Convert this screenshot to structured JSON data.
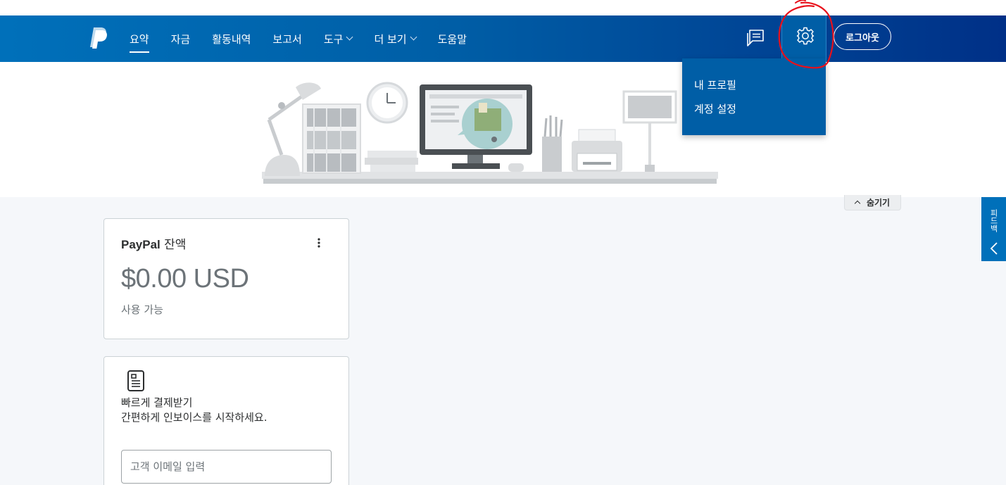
{
  "header": {
    "nav": [
      {
        "label": "요약",
        "active": true
      },
      {
        "label": "자금"
      },
      {
        "label": "활동내역"
      },
      {
        "label": "보고서"
      },
      {
        "label": "도구",
        "has_dropdown": true
      },
      {
        "label": "더 보기",
        "has_dropdown": true
      },
      {
        "label": "도움말"
      }
    ],
    "logout_label": "로그아웃"
  },
  "settings_menu": {
    "items": [
      "내 프로필",
      "계정 설정"
    ]
  },
  "hide_button_label": "숨기기",
  "feedback_tab_label": "피드백",
  "balance_card": {
    "title_brand": "PayPal",
    "title_rest": " 잔액",
    "amount": "$0.00 USD",
    "subtitle": "사용 가능"
  },
  "invoice_card": {
    "title": "빠르게 결제받기",
    "description": "간편하게 인보이스를 시작하세요.",
    "email_placeholder": "고객 이메일 입력"
  },
  "colors": {
    "header_primary": "#0070ba",
    "header_dark": "#003087",
    "dropdown_bg": "#005ea6",
    "annotation": "#e8101b",
    "page_bg": "#f5f7fa"
  },
  "icons": [
    "paypal-logo",
    "message-icon",
    "gear-icon",
    "kebab-icon",
    "invoice-icon",
    "chevron-left-icon",
    "chevron-up-icon"
  ]
}
